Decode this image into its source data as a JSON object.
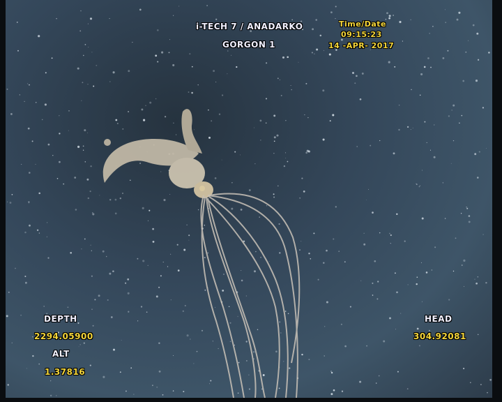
{
  "overlay": {
    "header_line1": "i-TECH 7 / ANADARKO",
    "header_line2": "GORGON 1",
    "time_label": "Time/Date",
    "time_value": "09:15:23",
    "date_value": "14 -APR- 2017",
    "depth_label": "DEPTH",
    "depth_value": "2294.05900",
    "alt_label": "ALT",
    "alt_value": "1.37816",
    "head_label": "HEAD",
    "head_value": "304.92081"
  },
  "colors": {
    "overlay_white": "#f0f0ff",
    "overlay_yellow": "#f5d63a",
    "water": "#3e5568"
  }
}
